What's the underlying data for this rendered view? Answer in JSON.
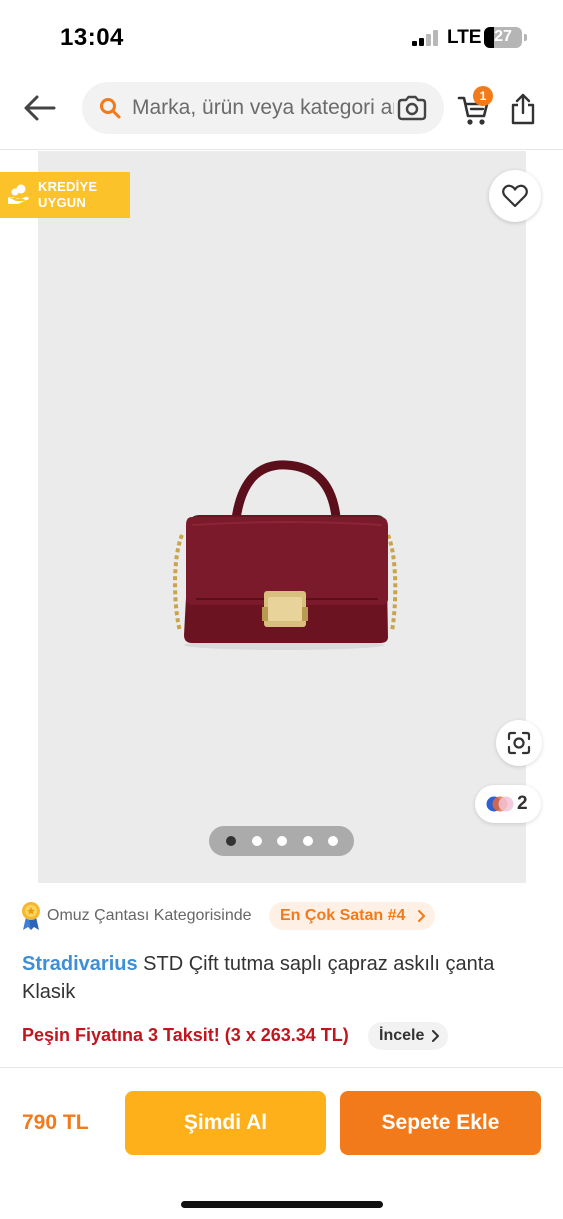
{
  "status_bar": {
    "time": "13:04",
    "network": "LTE",
    "battery_level": "27",
    "battery_fraction": 0.27
  },
  "header": {
    "search_placeholder": "Marka, ürün veya kategori ara",
    "cart_count": "1",
    "icons": [
      "back-arrow-icon",
      "search-icon",
      "camera-icon",
      "cart-icon",
      "share-icon"
    ]
  },
  "product_image": {
    "credit_badge_line1": "KREDİYE",
    "credit_badge_line2": "UYGUN",
    "variant_count": "2",
    "pager_total": 5,
    "pager_active": 1,
    "icons": [
      "credit-icon",
      "heart-icon",
      "visual-search-icon",
      "color-variants-icon"
    ]
  },
  "category": {
    "text": "Omuz Çantası Kategorisinde",
    "badge": "En Çok Satan #4"
  },
  "product": {
    "brand": "Stradivarius",
    "name": "STD Çift tutma saplı çapraz askılı çanta Klasik"
  },
  "installment": {
    "text": "Peşin Fiyatına 3 Taksit! (3 x 263.34 TL)",
    "inspect_label": "İncele"
  },
  "bottom_bar": {
    "price": "790 TL",
    "buy_now_label": "Şimdi Al",
    "add_to_cart_label": "Sepete Ekle"
  },
  "colors": {
    "accent_orange": "#f27a1a",
    "buy_now_yellow": "#fdb019",
    "credit_badge_yellow": "#fbc22a",
    "brand_blue": "#3f8fd6",
    "installment_red": "#c0161e",
    "bag_burgundy": "#6b1321"
  }
}
